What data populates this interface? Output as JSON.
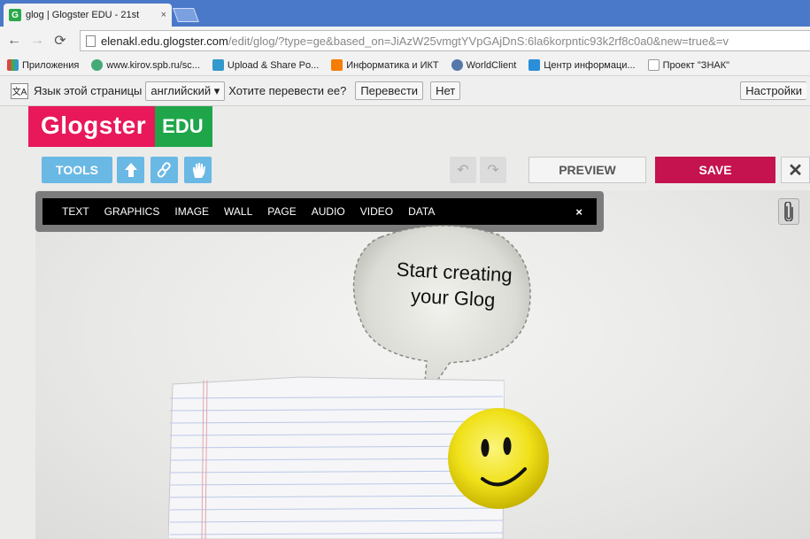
{
  "browser": {
    "tab_title": "glog | Glogster EDU - 21st",
    "tab_icon": "G",
    "tab_close": "×",
    "url_host": "elenakl.edu.glogster.com",
    "url_path": "/edit/glog/?type=ge&based_on=JiAzW25vmgtYVpGAjDnS:6la6korpntic93k2rf8c0a0&new=true&=v",
    "bookmarks": [
      {
        "label": "Приложения",
        "icon": "apps-icon",
        "color": "#d44"
      },
      {
        "label": "www.kirov.spb.ru/sc...",
        "icon": "site-icon",
        "color": "#4a7"
      },
      {
        "label": "Upload & Share Po...",
        "icon": "upload-icon",
        "color": "#39c"
      },
      {
        "label": "Информатика и ИКТ",
        "icon": "blogger-icon",
        "color": "#f57d00"
      },
      {
        "label": "WorldClient",
        "icon": "globe-icon",
        "color": "#5577aa"
      },
      {
        "label": "Центр информаци...",
        "icon": "site-icon",
        "color": "#2a8fd8"
      },
      {
        "label": "Проект \"ЗНАК\"",
        "icon": "page-icon",
        "color": "#ffffff"
      }
    ]
  },
  "translate_bar": {
    "prompt_lang": "Язык этой страницы",
    "language": "английский ▾",
    "question": "Хотите перевести ее?",
    "translate_btn": "Перевести",
    "no_btn": "Нет",
    "settings_btn": "Настройки"
  },
  "glogster": {
    "logo_main": "Glogster",
    "logo_edu": "EDU",
    "tools": "TOOLS",
    "preview": "PREVIEW",
    "save": "SAVE",
    "close": "✕",
    "menu": [
      "TEXT",
      "GRAPHICS",
      "IMAGE",
      "WALL",
      "PAGE",
      "AUDIO",
      "VIDEO",
      "DATA"
    ],
    "menu_close": "×",
    "bubble_line1": "Start creating",
    "bubble_line2": "your Glog"
  },
  "colors": {
    "brand_pink": "#e8185a",
    "brand_green": "#1fa64a",
    "tool_blue": "#6ab8e4",
    "save_red": "#c4134e"
  }
}
